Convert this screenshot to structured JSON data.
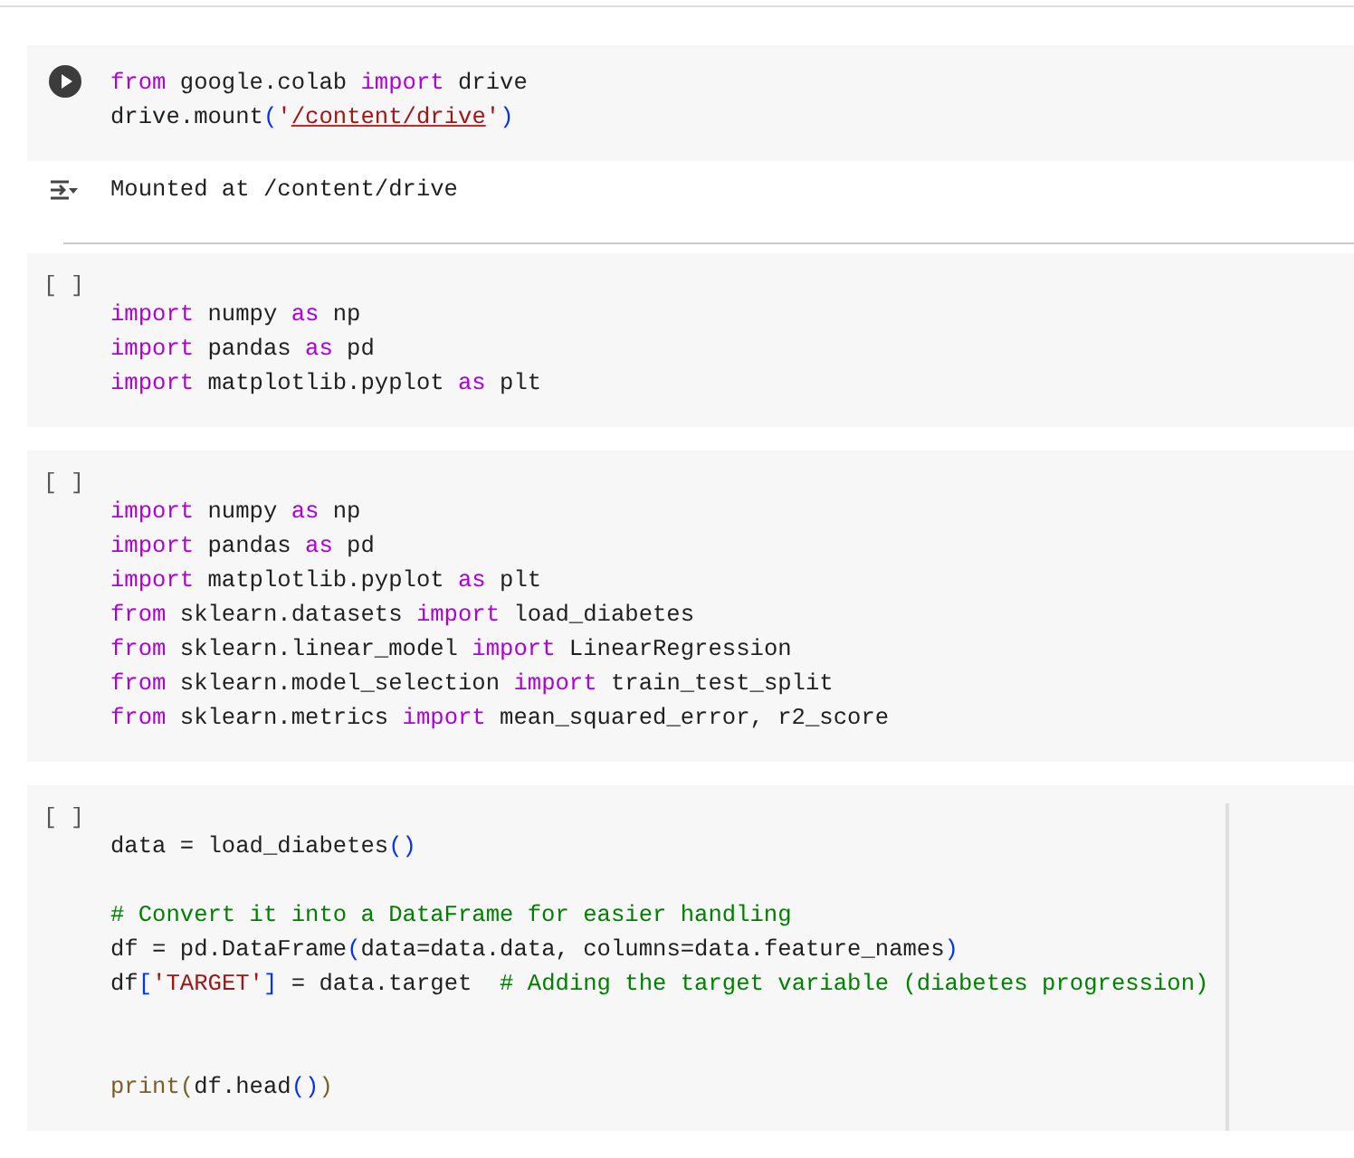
{
  "cells": [
    {
      "kind": "run",
      "lines": [
        {
          "kind": "code",
          "tokens": [
            {
              "kind": "keyword",
              "text": "from"
            },
            {
              "kind": "plain",
              "text": " google.colab "
            },
            {
              "kind": "keyword",
              "text": "import"
            },
            {
              "kind": "plain",
              "text": " drive"
            }
          ]
        },
        {
          "kind": "code",
          "tokens": [
            {
              "kind": "plain",
              "text": "drive.mount"
            },
            {
              "kind": "bracket",
              "text": "("
            },
            {
              "kind": "string",
              "text": "'"
            },
            {
              "kind": "string",
              "text": "/content/drive",
              "underlined": true
            },
            {
              "kind": "string",
              "text": "'"
            },
            {
              "kind": "bracket",
              "text": ")"
            }
          ]
        }
      ],
      "output": {
        "text": "Mounted at /content/drive"
      }
    },
    {
      "kind": "empty",
      "prompt": "[ ]",
      "lines": [
        {
          "kind": "code",
          "tokens": [
            {
              "kind": "keyword",
              "text": "import"
            },
            {
              "kind": "plain",
              "text": " numpy "
            },
            {
              "kind": "keyword",
              "text": "as"
            },
            {
              "kind": "plain",
              "text": " np"
            }
          ]
        },
        {
          "kind": "code",
          "tokens": [
            {
              "kind": "keyword",
              "text": "import"
            },
            {
              "kind": "plain",
              "text": " pandas "
            },
            {
              "kind": "keyword",
              "text": "as"
            },
            {
              "kind": "plain",
              "text": " pd"
            }
          ]
        },
        {
          "kind": "code",
          "tokens": [
            {
              "kind": "keyword",
              "text": "import"
            },
            {
              "kind": "plain",
              "text": " matplotlib.pyplot "
            },
            {
              "kind": "keyword",
              "text": "as"
            },
            {
              "kind": "plain",
              "text": " plt"
            }
          ]
        }
      ]
    },
    {
      "kind": "empty",
      "prompt": "[ ]",
      "lines": [
        {
          "kind": "code",
          "tokens": [
            {
              "kind": "keyword",
              "text": "import"
            },
            {
              "kind": "plain",
              "text": " numpy "
            },
            {
              "kind": "keyword",
              "text": "as"
            },
            {
              "kind": "plain",
              "text": " np"
            }
          ]
        },
        {
          "kind": "code",
          "tokens": [
            {
              "kind": "keyword",
              "text": "import"
            },
            {
              "kind": "plain",
              "text": " pandas "
            },
            {
              "kind": "keyword",
              "text": "as"
            },
            {
              "kind": "plain",
              "text": " pd"
            }
          ]
        },
        {
          "kind": "code",
          "tokens": [
            {
              "kind": "keyword",
              "text": "import"
            },
            {
              "kind": "plain",
              "text": " matplotlib.pyplot "
            },
            {
              "kind": "keyword",
              "text": "as"
            },
            {
              "kind": "plain",
              "text": " plt"
            }
          ]
        },
        {
          "kind": "code",
          "tokens": [
            {
              "kind": "keyword",
              "text": "from"
            },
            {
              "kind": "plain",
              "text": " sklearn.datasets "
            },
            {
              "kind": "keyword",
              "text": "import"
            },
            {
              "kind": "plain",
              "text": " load_diabetes"
            }
          ]
        },
        {
          "kind": "code",
          "tokens": [
            {
              "kind": "keyword",
              "text": "from"
            },
            {
              "kind": "plain",
              "text": " sklearn.linear_model "
            },
            {
              "kind": "keyword",
              "text": "import"
            },
            {
              "kind": "plain",
              "text": " LinearRegression"
            }
          ]
        },
        {
          "kind": "code",
          "tokens": [
            {
              "kind": "keyword",
              "text": "from"
            },
            {
              "kind": "plain",
              "text": " sklearn.model_selection "
            },
            {
              "kind": "keyword",
              "text": "import"
            },
            {
              "kind": "plain",
              "text": " train_test_split"
            }
          ]
        },
        {
          "kind": "code",
          "tokens": [
            {
              "kind": "keyword",
              "text": "from"
            },
            {
              "kind": "plain",
              "text": " sklearn.metrics "
            },
            {
              "kind": "keyword",
              "text": "import"
            },
            {
              "kind": "plain",
              "text": " mean_squared_error, r2_score"
            }
          ]
        }
      ]
    },
    {
      "kind": "empty",
      "prompt": "[ ]",
      "ruler": true,
      "lines": [
        {
          "kind": "code",
          "tokens": [
            {
              "kind": "plain",
              "text": "data = load_diabetes"
            },
            {
              "kind": "bracket",
              "text": "()"
            }
          ]
        },
        {
          "kind": "blank"
        },
        {
          "kind": "code",
          "tokens": [
            {
              "kind": "comment",
              "text": "# Convert it into a DataFrame for easier handling"
            }
          ]
        },
        {
          "kind": "code",
          "tokens": [
            {
              "kind": "plain",
              "text": "df = pd.DataFrame"
            },
            {
              "kind": "bracket",
              "text": "("
            },
            {
              "kind": "plain",
              "text": "data=data.data, columns=data.feature_names"
            },
            {
              "kind": "bracket",
              "text": ")"
            }
          ]
        },
        {
          "kind": "code",
          "tokens": [
            {
              "kind": "plain",
              "text": "df"
            },
            {
              "kind": "bracket",
              "text": "["
            },
            {
              "kind": "string",
              "text": "'TARGET'"
            },
            {
              "kind": "bracket",
              "text": "]"
            },
            {
              "kind": "plain",
              "text": " = data.target  "
            },
            {
              "kind": "comment",
              "text": "# Adding the target variable (diabetes progression)"
            }
          ]
        },
        {
          "kind": "blank"
        },
        {
          "kind": "blank"
        },
        {
          "kind": "code",
          "tokens": [
            {
              "kind": "builtin",
              "text": "print"
            },
            {
              "kind": "bracket-outer",
              "text": "("
            },
            {
              "kind": "plain",
              "text": "df.head"
            },
            {
              "kind": "bracket",
              "text": "()"
            },
            {
              "kind": "bracket-outer",
              "text": ")"
            }
          ]
        }
      ]
    }
  ]
}
